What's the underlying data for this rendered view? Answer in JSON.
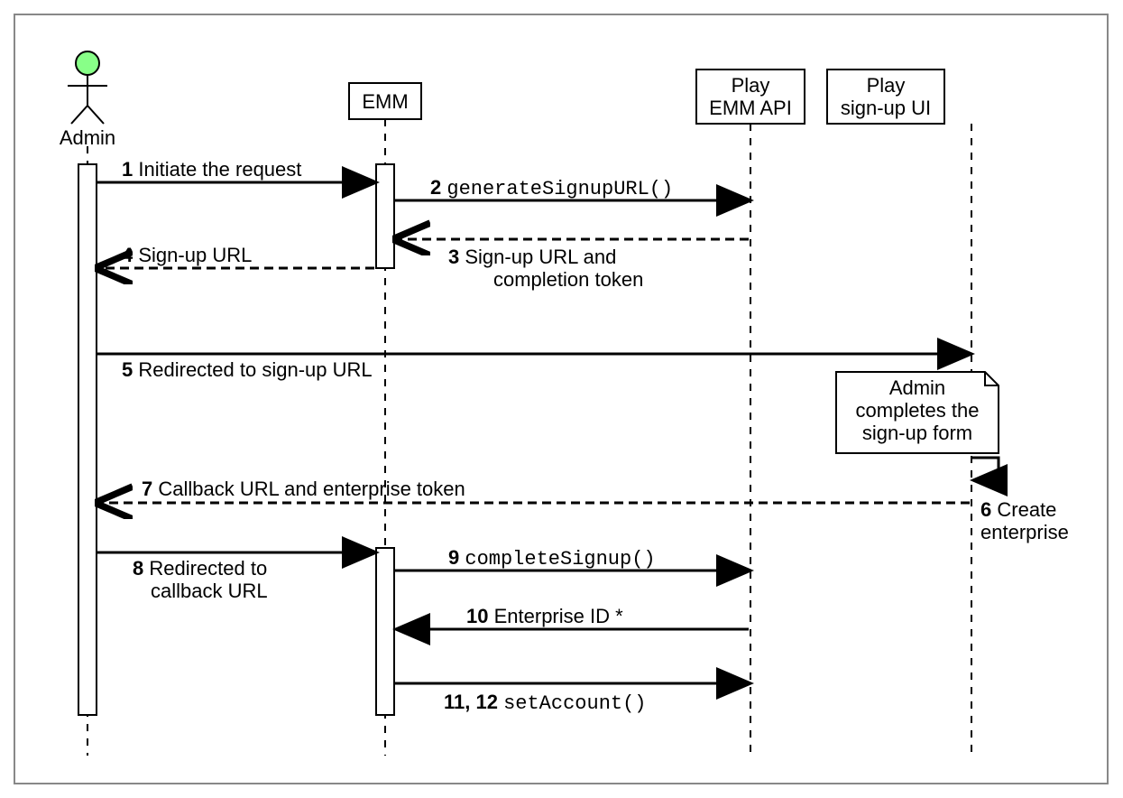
{
  "participants": {
    "admin": {
      "label": "Admin"
    },
    "emm": {
      "label": "EMM"
    },
    "play_api": {
      "label_line1": "Play",
      "label_line2": "EMM API"
    },
    "play_ui": {
      "label_line1": "Play",
      "label_line2": "sign-up UI"
    }
  },
  "messages": {
    "m1": {
      "num": "1",
      "text": "Initiate the request"
    },
    "m2": {
      "num": "2",
      "code": "generateSignupURL()"
    },
    "m3": {
      "num": "3",
      "text_l1": "Sign-up URL and",
      "text_l2": "completion token"
    },
    "m4": {
      "num": "4",
      "text": "Sign-up URL"
    },
    "m5": {
      "num": "5",
      "text": "Redirected to sign-up URL"
    },
    "m6": {
      "num": "6",
      "text_l1": "Create",
      "text_l2": "enterprise"
    },
    "m7": {
      "num": "7",
      "text": "Callback URL and enterprise token"
    },
    "m8": {
      "num": "8",
      "text_l1": "Redirected to",
      "text_l2": "callback URL"
    },
    "m9": {
      "num": "9",
      "code": "completeSignup()"
    },
    "m10": {
      "num": "10",
      "text": "Enterprise ID *"
    },
    "m11": {
      "num": "11, 12",
      "code": "setAccount()"
    }
  },
  "note": {
    "l1": "Admin",
    "l2": "completes the",
    "l3": "sign-up form"
  }
}
